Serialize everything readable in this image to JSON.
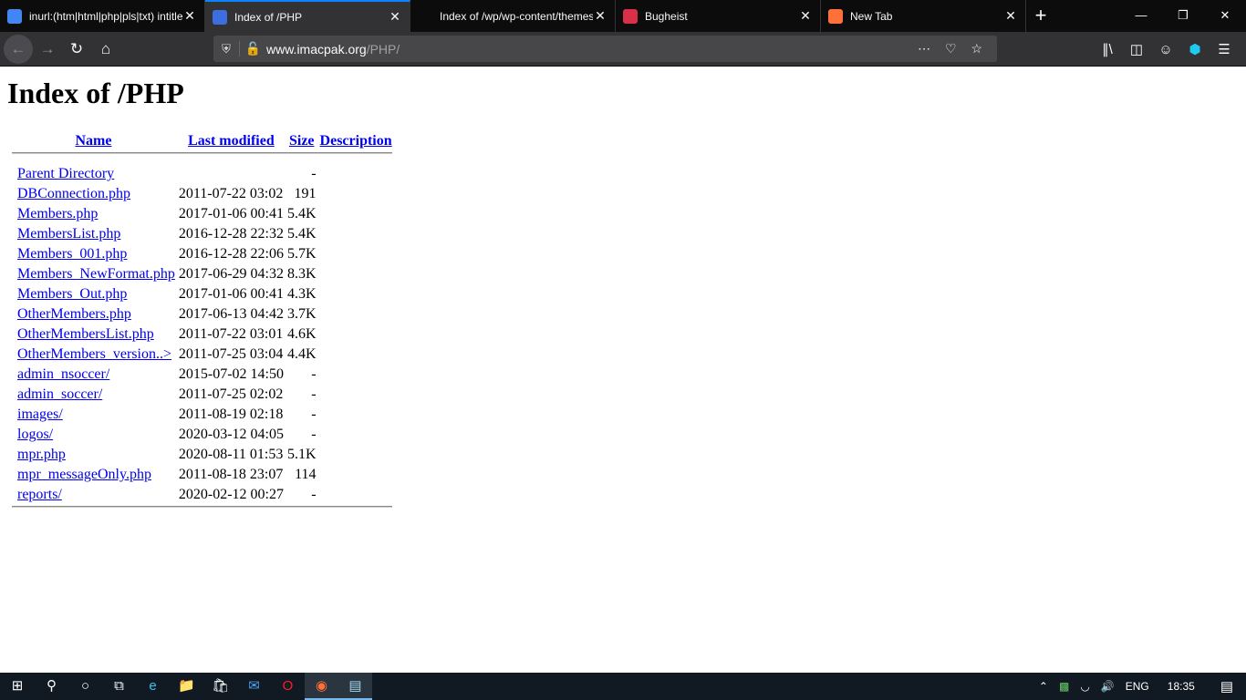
{
  "browser": {
    "tabs": [
      {
        "title": "inurl:(htm|html|php|pls|txt) intitle",
        "icon": "google-icon",
        "color": "#4285f4",
        "active": false
      },
      {
        "title": "Index of /PHP",
        "icon": "directory-icon",
        "color": "#3d6ee0",
        "active": true
      },
      {
        "title": "Index of /wp/wp-content/themes/P",
        "icon": "",
        "color": "",
        "active": false
      },
      {
        "title": "Bugheist",
        "icon": "bugheist-icon",
        "color": "#d9304a",
        "active": false
      },
      {
        "title": "New Tab",
        "icon": "firefox-icon",
        "color": "#ff7139",
        "active": false
      }
    ],
    "url_domain": "www.imacpak.org",
    "url_path": "/PHP/"
  },
  "page": {
    "title": "Index of /PHP",
    "headers": {
      "name": "Name",
      "modified": "Last modified",
      "size": "Size",
      "description": "Description"
    },
    "rows": [
      {
        "name": "Parent Directory",
        "modified": "",
        "size": "-"
      },
      {
        "name": "DBConnection.php",
        "modified": "2011-07-22 03:02",
        "size": "191"
      },
      {
        "name": "Members.php",
        "modified": "2017-01-06 00:41",
        "size": "5.4K"
      },
      {
        "name": "MembersList.php",
        "modified": "2016-12-28 22:32",
        "size": "5.4K"
      },
      {
        "name": "Members_001.php",
        "modified": "2016-12-28 22:06",
        "size": "5.7K"
      },
      {
        "name": "Members_NewFormat.php",
        "modified": "2017-06-29 04:32",
        "size": "8.3K"
      },
      {
        "name": "Members_Out.php",
        "modified": "2017-01-06 00:41",
        "size": "4.3K"
      },
      {
        "name": "OtherMembers.php",
        "modified": "2017-06-13 04:42",
        "size": "3.7K"
      },
      {
        "name": "OtherMembersList.php",
        "modified": "2011-07-22 03:01",
        "size": "4.6K"
      },
      {
        "name": "OtherMembers_version..>",
        "modified": "2011-07-25 03:04",
        "size": "4.4K"
      },
      {
        "name": "admin_nsoccer/",
        "modified": "2015-07-02 14:50",
        "size": "-"
      },
      {
        "name": "admin_soccer/",
        "modified": "2011-07-25 02:02",
        "size": "-"
      },
      {
        "name": "images/",
        "modified": "2011-08-19 02:18",
        "size": "-"
      },
      {
        "name": "logos/",
        "modified": "2020-03-12 04:05",
        "size": "-"
      },
      {
        "name": "mpr.php",
        "modified": "2020-08-11 01:53",
        "size": "5.1K"
      },
      {
        "name": "mpr_messageOnly.php",
        "modified": "2011-08-18 23:07",
        "size": "114"
      },
      {
        "name": "reports/",
        "modified": "2020-02-12 00:27",
        "size": "-"
      }
    ]
  },
  "taskbar": {
    "language": "ENG",
    "time": "18:35"
  }
}
